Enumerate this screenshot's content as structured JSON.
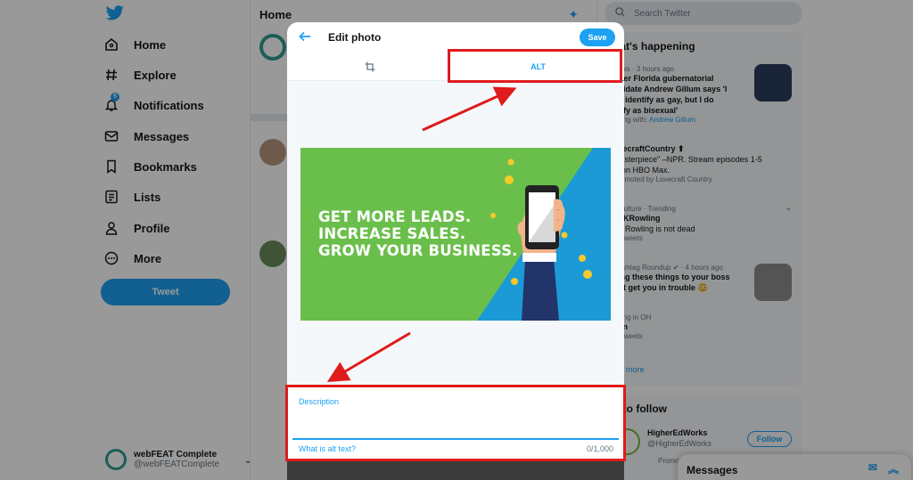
{
  "nav": {
    "items": [
      {
        "label": "Home",
        "icon": "home-icon"
      },
      {
        "label": "Explore",
        "icon": "hashtag-icon"
      },
      {
        "label": "Notifications",
        "icon": "bell-icon",
        "badge": "5"
      },
      {
        "label": "Messages",
        "icon": "envelope-icon"
      },
      {
        "label": "Bookmarks",
        "icon": "bookmark-icon"
      },
      {
        "label": "Lists",
        "icon": "list-icon"
      },
      {
        "label": "Profile",
        "icon": "person-icon"
      },
      {
        "label": "More",
        "icon": "more-icon"
      }
    ],
    "tweet_label": "Tweet",
    "account": {
      "name": "webFEAT Complete",
      "handle": "@webFEATComplete"
    }
  },
  "feed": {
    "title": "Home"
  },
  "sidebar": {
    "search_placeholder": "Search Twitter",
    "happening_title": "hat's happening",
    "trends": [
      {
        "meta": "news · 3 hours ago",
        "head1": "rmer Florida gubernatorial",
        "head2": "ndidate Andrew Gillum says 'I",
        "head3": "n't identify as gay, but I do",
        "head4": "ntify as bisexual'",
        "sub_prefix": "nding with:",
        "sub_link": "Andrew Gillum"
      },
      {
        "meta": "",
        "head1": "ovecraftCountry ⬆",
        "head2": "masterpiece\" –NPR. Stream episodes 1-5",
        "head3": "w on HBO Max.",
        "head4": "",
        "sub_prefix": "Promoted by Lovecraft Country",
        "sub_link": ""
      },
      {
        "meta": "& culture · Trending",
        "head1": "PJKRowling",
        "head2": "JK Rowling is not dead",
        "head3": "",
        "head4": "",
        "sub_prefix": "K Tweets",
        "sub_link": ""
      },
      {
        "meta": "Hashtag Roundup ✔ · 4 hours ago",
        "head1": "ying these things to your boss",
        "head2": "ght get you in trouble 😳",
        "head3": "",
        "head4": "",
        "sub_prefix": "",
        "sub_link": ""
      },
      {
        "meta": "nding in OH",
        "head1": "aun",
        "head2": "",
        "head3": "",
        "head4": "",
        "sub_prefix": "K Tweets",
        "sub_link": ""
      }
    ],
    "show_more": "ow more",
    "who_title": "o to follow",
    "follow": {
      "name": "HigherEdWorks",
      "handle": "@HigherEdWorks",
      "promoted": "Promo",
      "button": "Follow"
    }
  },
  "dock": {
    "title": "Messages"
  },
  "modal": {
    "title": "Edit photo",
    "save_label": "Save",
    "tab_alt": "ALT",
    "promo_lines": [
      "GET MORE LEADS.",
      "INCREASE SALES.",
      "GROW YOUR BUSINESS."
    ],
    "description_label": "Description",
    "alt_link": "What is alt text?",
    "char_count": "0/1,000"
  },
  "colors": {
    "accent": "#1da1f2",
    "annotation": "#e01b1b",
    "promo_green": "#6abf4b",
    "promo_blue": "#1b9ad6"
  }
}
